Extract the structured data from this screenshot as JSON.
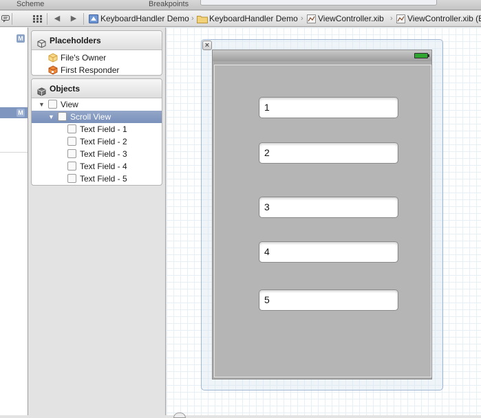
{
  "toolbar": {
    "scheme_label": "Scheme",
    "breakpoints_label": "Breakpoints"
  },
  "jumpbar": {
    "breadcrumbs": [
      {
        "label": "KeyboardHandler Demo",
        "icon": "project-icon"
      },
      {
        "label": "KeyboardHandler Demo",
        "icon": "folder-icon"
      },
      {
        "label": "ViewController.xib",
        "icon": "xib-icon"
      },
      {
        "label": "ViewController.xib (E",
        "icon": "xib-icon"
      }
    ]
  },
  "navigator": {
    "badges": [
      "M",
      "M"
    ]
  },
  "outline": {
    "placeholders": {
      "title": "Placeholders",
      "items": [
        {
          "label": "File's Owner",
          "icon": "files-owner-cube-icon"
        },
        {
          "label": "First Responder",
          "icon": "first-responder-cube-icon"
        }
      ]
    },
    "objects": {
      "title": "Objects",
      "tree": [
        {
          "label": "View",
          "level": 0,
          "expanded": true,
          "selected": false
        },
        {
          "label": "Scroll View",
          "level": 1,
          "expanded": true,
          "selected": true
        },
        {
          "label": "Text Field - 1",
          "level": 2,
          "selected": false
        },
        {
          "label": "Text Field - 2",
          "level": 2,
          "selected": false
        },
        {
          "label": "Text Field - 3",
          "level": 2,
          "selected": false
        },
        {
          "label": "Text Field - 4",
          "level": 2,
          "selected": false
        },
        {
          "label": "Text Field - 5",
          "level": 2,
          "selected": false
        }
      ]
    }
  },
  "canvas": {
    "text_fields": [
      "1",
      "2",
      "3",
      "4",
      "5"
    ]
  },
  "colors": {
    "selection": "#7f96bf",
    "scroll_view_bg": "#b5b5b5",
    "battery": "#2ea52e"
  }
}
